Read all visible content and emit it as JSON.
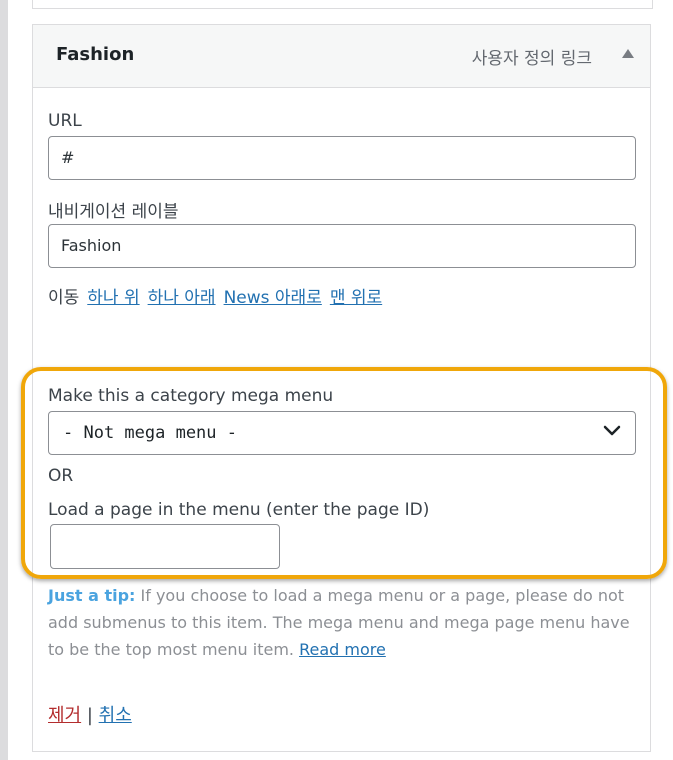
{
  "menu_item": {
    "title": "Fashion",
    "type": "사용자 정의 링크"
  },
  "url_field": {
    "label": "URL",
    "value": "#"
  },
  "nav_label_field": {
    "label": "내비게이션 레이블",
    "value": "Fashion"
  },
  "move": {
    "label": "이동",
    "links": [
      "하나 위",
      "하나 아래",
      "News 아래로",
      "맨 위로"
    ]
  },
  "mega_menu": {
    "label": "Make this a category mega menu",
    "selected": "- Not mega menu -",
    "or_text": "OR",
    "page_label": "Load a page in the menu (enter the page ID)",
    "page_value": ""
  },
  "tip": {
    "strong": "Just a tip:",
    "text": " If you choose to load a mega menu or a page, please do not add submenus to this item. The mega menu and mega page menu have to be the top most menu item. ",
    "link": "Read more"
  },
  "actions": {
    "remove": "제거",
    "separator": " | ",
    "cancel": "취소"
  },
  "colors": {
    "highlight": "#f0a70a",
    "link": "#2271b1",
    "remove": "#b32d2e",
    "tip_strong": "#4aa3df"
  }
}
